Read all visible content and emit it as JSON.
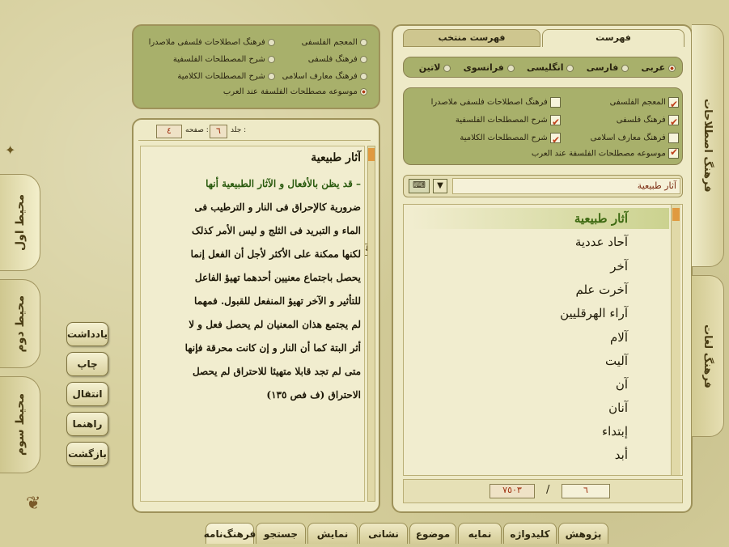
{
  "left_tabs": [
    "محیط اول",
    "محیط دوم",
    "محیط سوم"
  ],
  "side_buttons": [
    "یادداشت",
    "چاپ",
    "انتقال",
    "راهنما",
    "بازگشت"
  ],
  "source_list": {
    "col_right": [
      "المعجم الفلسفی",
      "فرهنگ فلسفی",
      "فرهنگ معارف اسلامی"
    ],
    "col_left": [
      "فرهنگ اصطلاحات فلسفی ملاصدرا",
      "شرح المصطلحات الفلسفیة",
      "شرح المصطلحات الکلامیة"
    ],
    "bottom": "موسوعه مصطلحات الفلسفة عند العرب"
  },
  "toolbar": {
    "page_label": "صفحه :",
    "page_value": "٤",
    "volume_label": "جلد :",
    "volume_value": "٦"
  },
  "article": {
    "title": "آثار طبیعیة",
    "lines": [
      "– قد یظن بالأفعال و الآثار الطبیعیة أنها",
      "ضروریة کالإحراق فی النار و الترطیب فی",
      "الماء و التبرید فی الثلج و لیس الأمر کذلک",
      "لکنها ممکنة على الأکثر لأجل أن الفعل إنما",
      "یحصل باجتماع معنیین أحدهما تهیؤ الفاعل",
      "للتأثیر و الآخر تهیؤ المنفعل للقبول. فمهما",
      "لم یجتمع هذان المعنیان لم یحصل فعل و لا",
      "أثر البتة کما أن النار و إن کانت محرقة فإنها",
      "متى لم  تجد قابلا متهیئا للاحتراق لم یحصل",
      "الاحتراق (ف فص ١٣٥)"
    ]
  },
  "right_tabs": {
    "index": "فهرست",
    "selected_index": "فهرست منتخب"
  },
  "languages": [
    "عربی",
    "فارسی",
    "انگلیسی",
    "فرانسوی",
    "لاتین"
  ],
  "dictionaries": {
    "col_right": [
      "المعجم الفلسفی",
      "فرهنگ فلسفی",
      "فرهنگ معارف اسلامی"
    ],
    "col_left": [
      "فرهنگ اصطلاحات فلسفی ملاصدرا",
      "شرح المصطلحات الفلسفیة",
      "شرح المصطلحات الکلامیة"
    ],
    "bottom": "موسوعه مصطلحات الفلسفة عند العرب"
  },
  "search": {
    "value": "آثار طبیعیة"
  },
  "terms": [
    "آثار طبیعیة",
    "آحاد عددیة",
    "آخر",
    "آخرت علم",
    "آراء الهرقلیین",
    "آلام",
    "آلیت",
    "آن",
    "آنان",
    "إبتداء",
    "أبد"
  ],
  "counter": {
    "current": "٦",
    "separator": "/",
    "total": "٧٥٠٣"
  },
  "right_side_tabs": [
    "فرهنگ اصطلاحات",
    "فرهنگ لغات"
  ],
  "bottom_tabs": [
    "پژوهش",
    "کلیدواژه",
    "نمایه",
    "موضوع",
    "نشانی",
    "نمایش",
    "جستجو",
    "فرهنگ‌نامه"
  ]
}
